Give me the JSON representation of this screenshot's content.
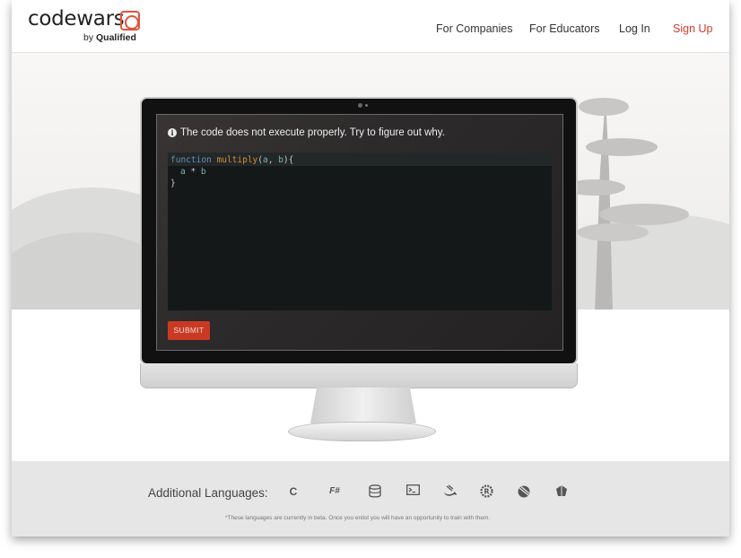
{
  "brand": {
    "name": "codewars",
    "sub_prefix": "by",
    "sub_name": "Qualified"
  },
  "nav": {
    "for_companies": "For Companies",
    "for_educators": "For Educators",
    "log_in": "Log In",
    "sign_up": "Sign Up"
  },
  "challenge": {
    "prompt": "The code does not execute properly. Try to figure out why.",
    "code": {
      "line1_kw": "function",
      "line1_fn": "multiply",
      "line1_p1": "(",
      "line1_a": "a",
      "line1_comma": ", ",
      "line1_b": "b",
      "line1_p2": "){",
      "line2_a": "a",
      "line2_op": " * ",
      "line2_b": "b",
      "line3": "}"
    },
    "submit_label": "SUBMIT"
  },
  "languages": {
    "title": "Additional Languages:",
    "icons": [
      "c-icon",
      "fsharp-icon",
      "sql-icon",
      "shell-icon",
      "swift-icon",
      "rust-icon",
      "objective-c-icon",
      "elixir-icon"
    ],
    "c_label": "C",
    "fsharp_label": "F#",
    "note": "*These languages are currently in beta. Once you enlist you will have an opportunity to train with them."
  },
  "colors": {
    "accent": "#d23c2c",
    "submit": "#c93a25"
  }
}
